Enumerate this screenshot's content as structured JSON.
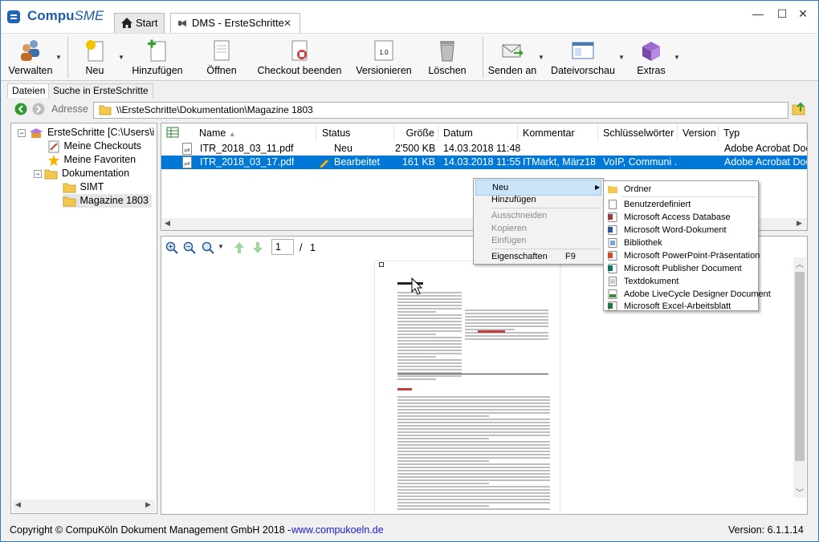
{
  "app": {
    "title_bold": "Compu",
    "title_italic": "SME"
  },
  "tabs": [
    {
      "label": "Start"
    },
    {
      "label": "DMS - ErsteSchritte"
    }
  ],
  "window_controls": {
    "minimize": "—",
    "maximize": "☐",
    "close": "✕"
  },
  "toolbar": {
    "verwalten": "Verwalten",
    "neu": "Neu",
    "hinzufuegen": "Hinzufügen",
    "oeffnen": "Öffnen",
    "checkout_beenden": "Checkout beenden",
    "versionieren": "Versionieren",
    "loeschen": "Löschen",
    "senden_an": "Senden an",
    "dateivorschau": "Dateivorschau",
    "extras": "Extras",
    "version_badge": "1.0"
  },
  "subtabs": [
    "Dateien",
    "Suche in ErsteSchritte"
  ],
  "address": {
    "label": "Adresse",
    "path": "\\\\ErsteSchritte\\Dokumentation\\Magazine 1803"
  },
  "tree": [
    "ErsteSchritte  [C:\\Users\\i",
    "Meine Checkouts",
    "Meine Favoriten",
    "Dokumentation",
    "SIMT",
    "Magazine 1803"
  ],
  "columns": [
    "Name",
    "Status",
    "Größe",
    "Datum",
    "Kommentar",
    "Schlüsselwörter",
    "Version",
    "Typ"
  ],
  "files": [
    {
      "name": "ITR_2018_03_11.pdf",
      "status": "Neu",
      "size": "2'500 KB",
      "date": "14.03.2018 11:48",
      "comment": "",
      "keywords": "",
      "version": "",
      "type": "Adobe Acrobat Doc"
    },
    {
      "name": "ITR_2018_03_17.pdf",
      "status": "Bearbeitet",
      "size": "161 KB",
      "date": "14.03.2018 11:55",
      "comment": "ITMarkt, März18",
      "keywords": "VoIP, Communi ...",
      "version": "",
      "type": "Adobe Acrobat Doc"
    }
  ],
  "preview": {
    "page_current": "1",
    "page_sep": "/",
    "page_total": "1"
  },
  "context_menu": {
    "items": [
      "Neu",
      "Hinzufügen",
      "Ausschneiden",
      "Kopieren",
      "Einfügen",
      "Eigenschaften"
    ],
    "shortcut": "F9"
  },
  "submenu": [
    "Ordner",
    "Benutzerdefiniert",
    "Microsoft Access Database",
    "Microsoft Word-Dokument",
    "Bibliothek",
    "Microsoft PowerPoint-Präsentation",
    "Microsoft Publisher Document",
    "Textdokument",
    "Adobe LiveCycle Designer Document",
    "Microsoft Excel-Arbeitsblatt"
  ],
  "status": {
    "copyright": "Copyright © CompuKöln Dokument Management GmbH 2018  -",
    "link": "www.compukoeln.de",
    "version": "Version:  6.1.1.14"
  },
  "colors": {
    "selection": "#0078d7",
    "accent": "#1f5fa8",
    "link": "#0000cc",
    "menu_highlight": "#cce4f7"
  }
}
